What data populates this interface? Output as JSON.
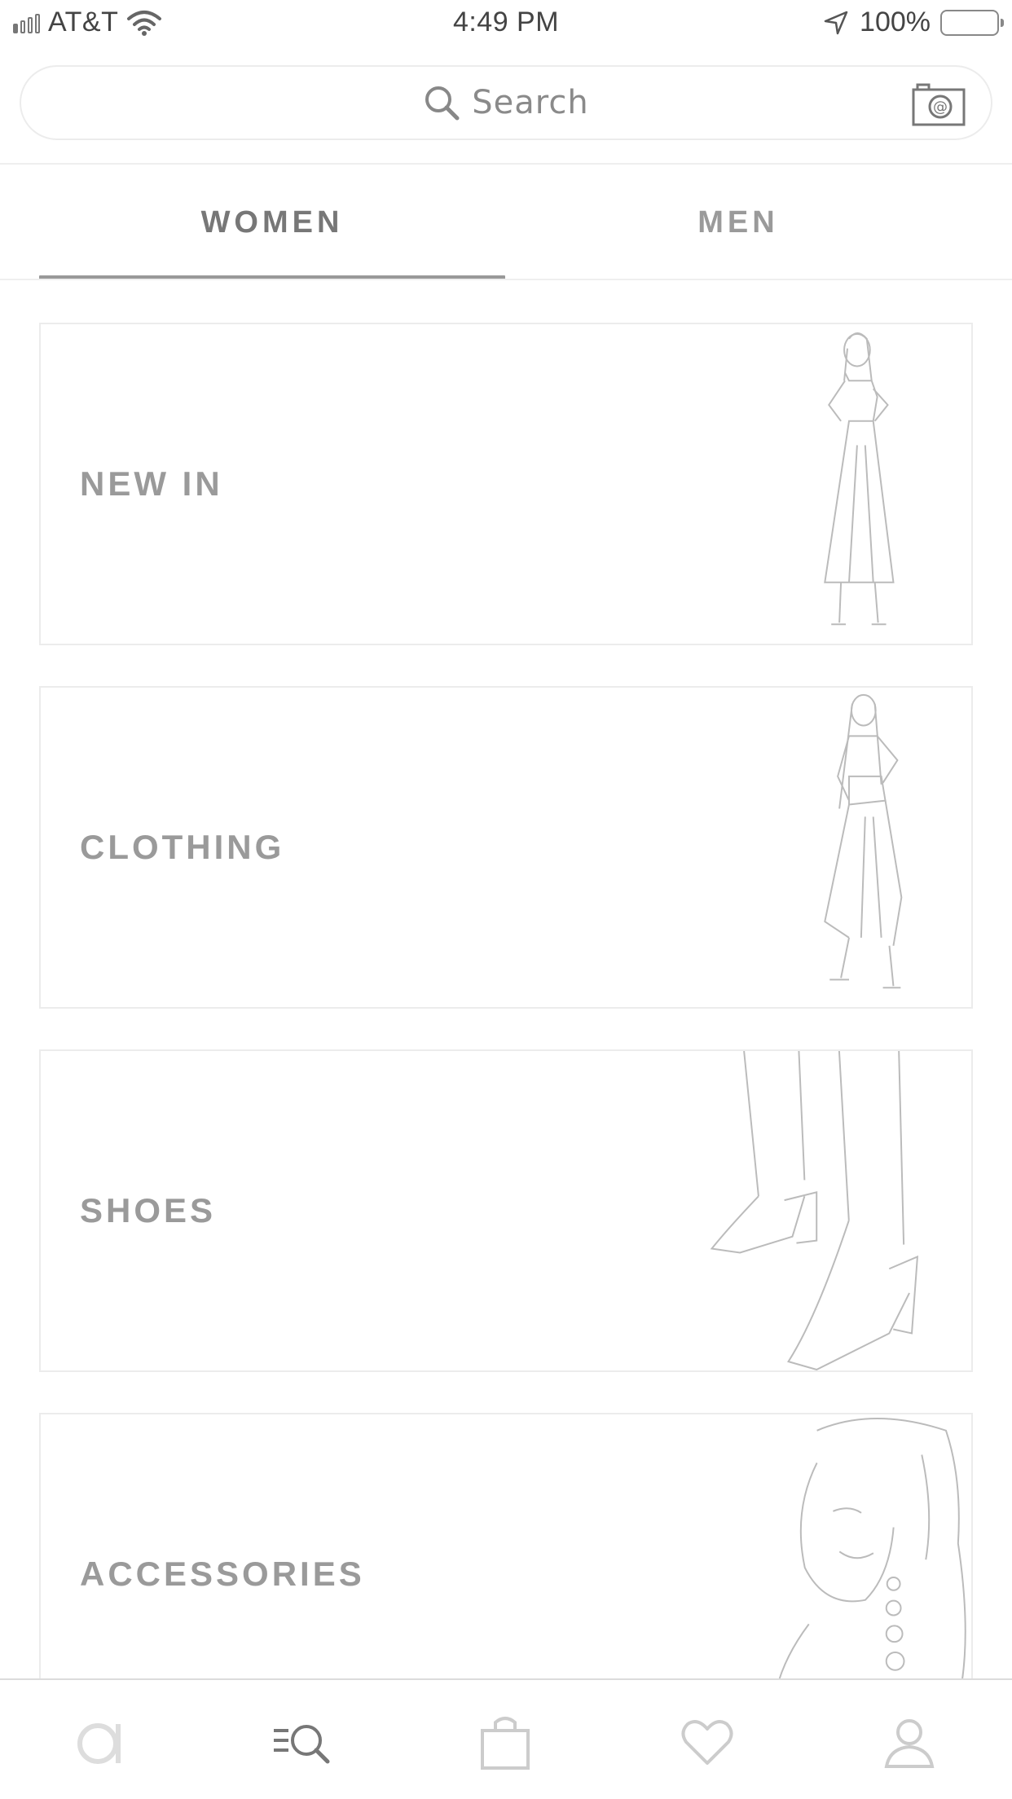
{
  "status_bar": {
    "carrier": "AT&T",
    "time": "4:49 PM",
    "battery": "100%",
    "signal_bars_filled": 1,
    "signal_bars_total": 4,
    "icons": [
      "wifi-icon",
      "location-arrow-icon",
      "battery-icon"
    ]
  },
  "search": {
    "placeholder": "Search",
    "icons": [
      "search-icon",
      "camera-icon"
    ]
  },
  "tabs": [
    {
      "label": "WOMEN",
      "selected": true
    },
    {
      "label": "MEN",
      "selected": false
    }
  ],
  "categories": [
    {
      "label": "NEW IN",
      "image": "model-in-wrap-jumpsuit"
    },
    {
      "label": "CLOTHING",
      "image": "model-in-cargo-jumpsuit"
    },
    {
      "label": "SHOES",
      "image": "heeled-sandals-on-feet"
    },
    {
      "label": "ACCESSORIES",
      "image": "model-wearing-earrings"
    }
  ],
  "bottom_nav": [
    {
      "name": "home",
      "icon": "brand-a-icon",
      "active": false
    },
    {
      "name": "categories",
      "icon": "browse-search-icon",
      "active": true
    },
    {
      "name": "bag",
      "icon": "shopping-bag-icon",
      "active": false
    },
    {
      "name": "saved",
      "icon": "heart-icon",
      "active": false
    },
    {
      "name": "account",
      "icon": "profile-icon",
      "active": false
    }
  ],
  "colors": {
    "background": "#ffffff",
    "text_muted": "#9a9a9a",
    "border": "#ececec",
    "active_underline": "#999999"
  }
}
